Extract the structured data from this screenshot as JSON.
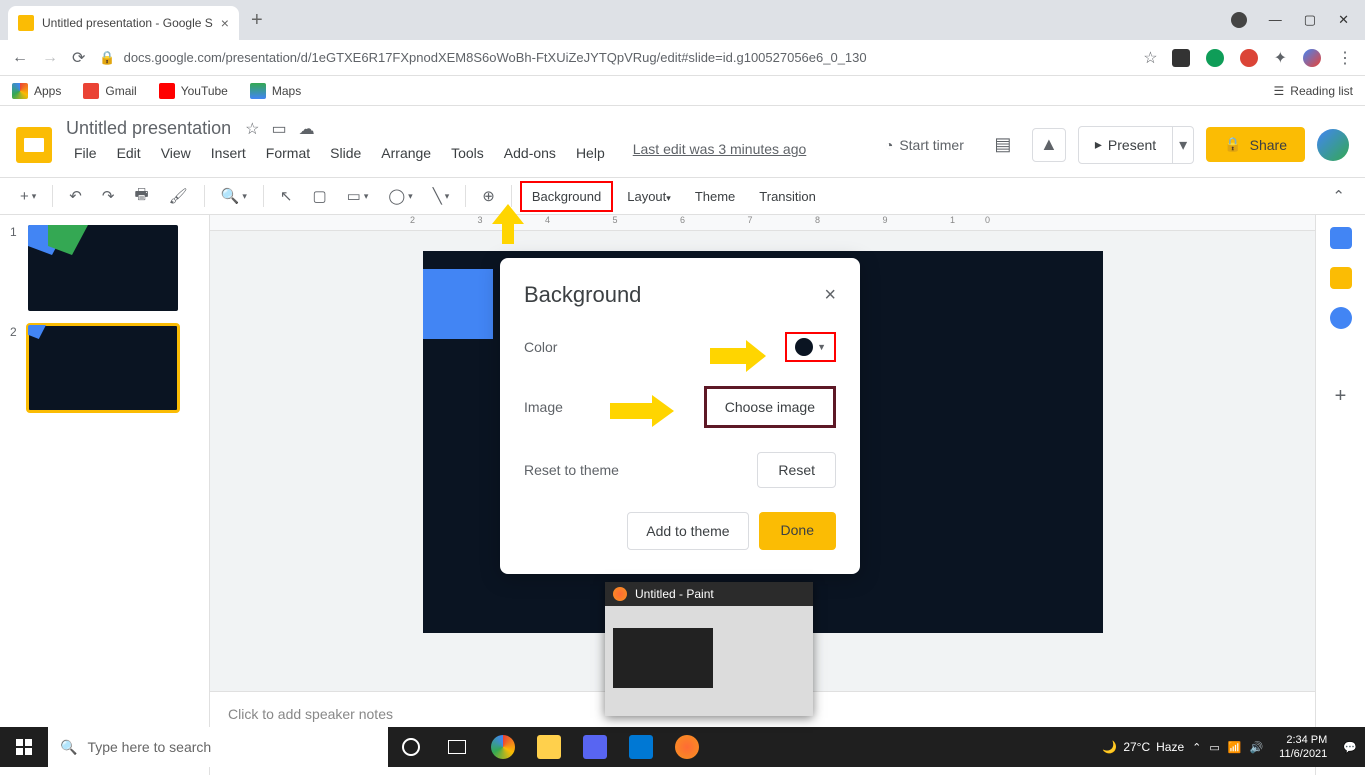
{
  "browser": {
    "tab_title": "Untitled presentation - Google S",
    "url": "docs.google.com/presentation/d/1eGTXE6R17FXpnodXEM8S6oWoBh-FtXUiZeJYTQpVRug/edit#slide=id.g100527056e6_0_130",
    "new_tab": "+"
  },
  "bookmarks": {
    "apps": "Apps",
    "gmail": "Gmail",
    "youtube": "YouTube",
    "maps": "Maps",
    "reading": "Reading list"
  },
  "doc": {
    "title": "Untitled presentation",
    "last_edit": "Last edit was 3 minutes ago",
    "start_timer": "Start timer",
    "present": "Present",
    "share": "Share"
  },
  "menus": {
    "file": "File",
    "edit": "Edit",
    "view": "View",
    "insert": "Insert",
    "format": "Format",
    "slide": "Slide",
    "arrange": "Arrange",
    "tools": "Tools",
    "addons": "Add-ons",
    "help": "Help"
  },
  "toolbar": {
    "background": "Background",
    "layout": "Layout",
    "theme": "Theme",
    "transition": "Transition"
  },
  "thumbs": {
    "n1": "1",
    "n2": "2"
  },
  "notes": {
    "placeholder": "Click to add speaker notes"
  },
  "dialog": {
    "title": "Background",
    "color": "Color",
    "image": "Image",
    "choose_image": "Choose image",
    "reset_theme": "Reset to theme",
    "reset": "Reset",
    "add_theme": "Add to theme",
    "done": "Done"
  },
  "paint": {
    "title": "Untitled - Paint"
  },
  "taskbar": {
    "search": "Type here to search",
    "weather_temp": "27°C",
    "weather_cond": "Haze",
    "time": "2:34 PM",
    "date": "11/6/2021"
  },
  "ruler": "2 3 4 5 6 7 8 9 10"
}
